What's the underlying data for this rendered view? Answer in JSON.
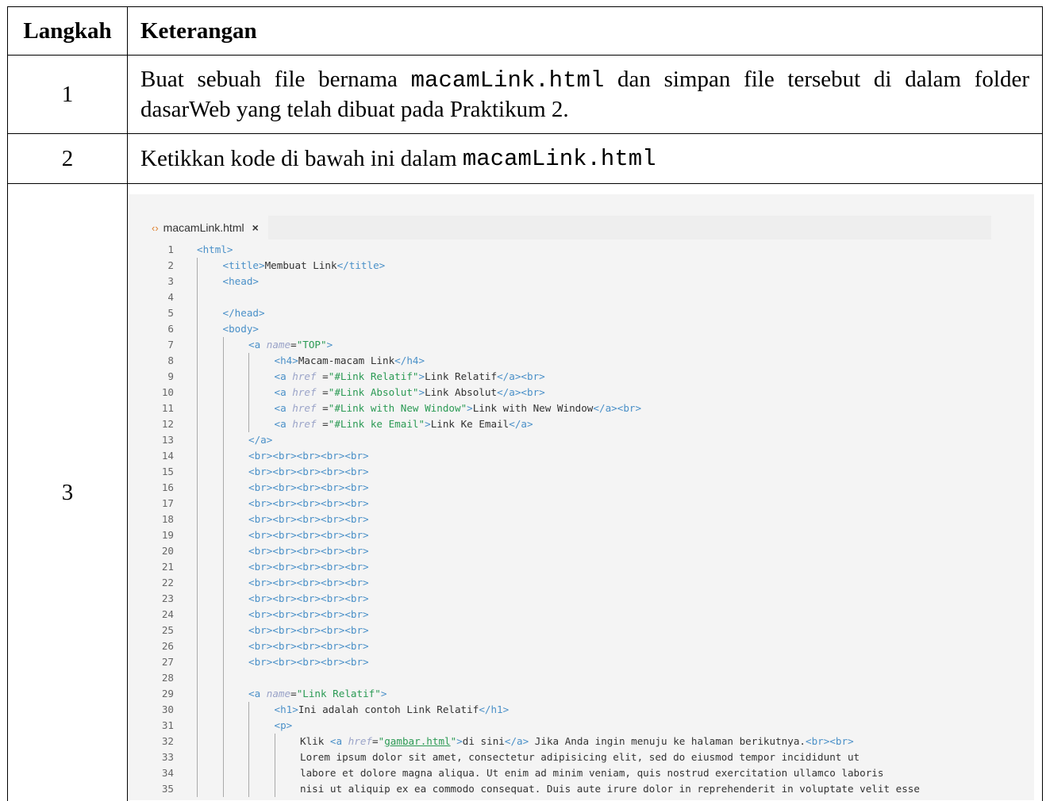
{
  "table": {
    "header": {
      "step": "Langkah",
      "description": "Keterangan"
    },
    "rows": [
      {
        "step": "1",
        "text_before": "Buat sebuah file bernama",
        "filename": "macamLink.html",
        "text_after": "dan simpan file tersebut di dalam folder dasarWeb yang telah dibuat pada Praktikum 2."
      },
      {
        "step": "2",
        "text_before": "Ketikkan kode di bawah ini dalam",
        "filename": "macamLink.html"
      },
      {
        "step": "3"
      }
    ]
  },
  "editor": {
    "tab_label": "macamLink.html",
    "tab_icon": "code-file-icon",
    "close_icon": "close-icon",
    "lines": [
      {
        "n": "1",
        "indent": 0,
        "parts": [
          [
            "t",
            "<html>"
          ]
        ]
      },
      {
        "n": "2",
        "indent": 1,
        "parts": [
          [
            "t",
            "<title>"
          ],
          [
            "tx",
            "Membuat Link"
          ],
          [
            "t",
            "</title>"
          ]
        ]
      },
      {
        "n": "3",
        "indent": 1,
        "parts": [
          [
            "t",
            "<head>"
          ]
        ]
      },
      {
        "n": "4",
        "indent": 1,
        "parts": []
      },
      {
        "n": "5",
        "indent": 1,
        "parts": [
          [
            "t",
            "</head>"
          ]
        ]
      },
      {
        "n": "6",
        "indent": 1,
        "parts": [
          [
            "t",
            "<body>"
          ]
        ]
      },
      {
        "n": "7",
        "indent": 2,
        "parts": [
          [
            "t",
            "<a "
          ],
          [
            "an",
            "name"
          ],
          [
            "tx",
            "="
          ],
          [
            "av",
            "\"TOP\""
          ],
          [
            "t",
            ">"
          ]
        ]
      },
      {
        "n": "8",
        "indent": 3,
        "parts": [
          [
            "t",
            "<h4>"
          ],
          [
            "tx",
            "Macam-macam Link"
          ],
          [
            "t",
            "</h4>"
          ]
        ]
      },
      {
        "n": "9",
        "indent": 3,
        "parts": [
          [
            "t",
            "<a "
          ],
          [
            "an",
            "href"
          ],
          [
            "tx",
            " ="
          ],
          [
            "av",
            "\"#Link Relatif\""
          ],
          [
            "t",
            ">"
          ],
          [
            "tx",
            "Link Relatif"
          ],
          [
            "t",
            "</a><br>"
          ]
        ]
      },
      {
        "n": "10",
        "indent": 3,
        "parts": [
          [
            "t",
            "<a "
          ],
          [
            "an",
            "href"
          ],
          [
            "tx",
            " ="
          ],
          [
            "av",
            "\"#Link Absolut\""
          ],
          [
            "t",
            ">"
          ],
          [
            "tx",
            "Link Absolut"
          ],
          [
            "t",
            "</a><br>"
          ]
        ]
      },
      {
        "n": "11",
        "indent": 3,
        "parts": [
          [
            "t",
            "<a "
          ],
          [
            "an",
            "href"
          ],
          [
            "tx",
            " ="
          ],
          [
            "av",
            "\"#Link with New Window\""
          ],
          [
            "t",
            ">"
          ],
          [
            "tx",
            "Link with New Window"
          ],
          [
            "t",
            "</a><br>"
          ]
        ]
      },
      {
        "n": "12",
        "indent": 3,
        "parts": [
          [
            "t",
            "<a "
          ],
          [
            "an",
            "href"
          ],
          [
            "tx",
            " ="
          ],
          [
            "av",
            "\"#Link ke Email\""
          ],
          [
            "t",
            ">"
          ],
          [
            "tx",
            "Link Ke Email"
          ],
          [
            "t",
            "</a>"
          ]
        ]
      },
      {
        "n": "13",
        "indent": 2,
        "parts": [
          [
            "t",
            "</a>"
          ]
        ]
      },
      {
        "n": "14",
        "indent": 2,
        "parts": [
          [
            "t",
            "<br><br><br><br><br>"
          ]
        ]
      },
      {
        "n": "15",
        "indent": 2,
        "parts": [
          [
            "t",
            "<br><br><br><br><br>"
          ]
        ]
      },
      {
        "n": "16",
        "indent": 2,
        "parts": [
          [
            "t",
            "<br><br><br><br><br>"
          ]
        ]
      },
      {
        "n": "17",
        "indent": 2,
        "parts": [
          [
            "t",
            "<br><br><br><br><br>"
          ]
        ]
      },
      {
        "n": "18",
        "indent": 2,
        "parts": [
          [
            "t",
            "<br><br><br><br><br>"
          ]
        ]
      },
      {
        "n": "19",
        "indent": 2,
        "parts": [
          [
            "t",
            "<br><br><br><br><br>"
          ]
        ]
      },
      {
        "n": "20",
        "indent": 2,
        "parts": [
          [
            "t",
            "<br><br><br><br><br>"
          ]
        ]
      },
      {
        "n": "21",
        "indent": 2,
        "parts": [
          [
            "t",
            "<br><br><br><br><br>"
          ]
        ]
      },
      {
        "n": "22",
        "indent": 2,
        "parts": [
          [
            "t",
            "<br><br><br><br><br>"
          ]
        ]
      },
      {
        "n": "23",
        "indent": 2,
        "parts": [
          [
            "t",
            "<br><br><br><br><br>"
          ]
        ]
      },
      {
        "n": "24",
        "indent": 2,
        "parts": [
          [
            "t",
            "<br><br><br><br><br>"
          ]
        ]
      },
      {
        "n": "25",
        "indent": 2,
        "parts": [
          [
            "t",
            "<br><br><br><br><br>"
          ]
        ]
      },
      {
        "n": "26",
        "indent": 2,
        "parts": [
          [
            "t",
            "<br><br><br><br><br>"
          ]
        ]
      },
      {
        "n": "27",
        "indent": 2,
        "parts": [
          [
            "t",
            "<br><br><br><br><br>"
          ]
        ]
      },
      {
        "n": "28",
        "indent": 2,
        "parts": []
      },
      {
        "n": "29",
        "indent": 2,
        "parts": [
          [
            "t",
            "<a "
          ],
          [
            "an",
            "name"
          ],
          [
            "tx",
            "="
          ],
          [
            "av",
            "\"Link Relatif\""
          ],
          [
            "t",
            ">"
          ]
        ]
      },
      {
        "n": "30",
        "indent": 3,
        "parts": [
          [
            "t",
            "<h1>"
          ],
          [
            "tx",
            "Ini adalah contoh Link Relatif"
          ],
          [
            "t",
            "</h1>"
          ]
        ]
      },
      {
        "n": "31",
        "indent": 3,
        "parts": [
          [
            "t",
            "<p>"
          ]
        ]
      },
      {
        "n": "32",
        "indent": 4,
        "parts": [
          [
            "tx",
            "Klik "
          ],
          [
            "t",
            "<a "
          ],
          [
            "an",
            "href"
          ],
          [
            "tx",
            "="
          ],
          [
            "av",
            "\""
          ],
          [
            "lk",
            "gambar.html"
          ],
          [
            "av",
            "\""
          ],
          [
            "t",
            ">"
          ],
          [
            "tx",
            "di sini"
          ],
          [
            "t",
            "</a>"
          ],
          [
            "tx",
            " Jika Anda ingin menuju ke halaman berikutnya."
          ],
          [
            "t",
            "<br><br>"
          ]
        ]
      },
      {
        "n": "33",
        "indent": 4,
        "parts": [
          [
            "tx",
            "Lorem ipsum dolor sit amet, consectetur adipisicing elit, sed do eiusmod tempor incididunt ut"
          ]
        ]
      },
      {
        "n": "34",
        "indent": 4,
        "parts": [
          [
            "tx",
            "labore et dolore magna aliqua. Ut enim ad minim veniam, quis nostrud exercitation ullamco laboris"
          ]
        ]
      },
      {
        "n": "35",
        "indent": 4,
        "parts": [
          [
            "tx",
            "nisi ut aliquip ex ea commodo consequat. Duis aute irure dolor in reprehenderit in voluptate velit esse"
          ]
        ]
      }
    ]
  }
}
